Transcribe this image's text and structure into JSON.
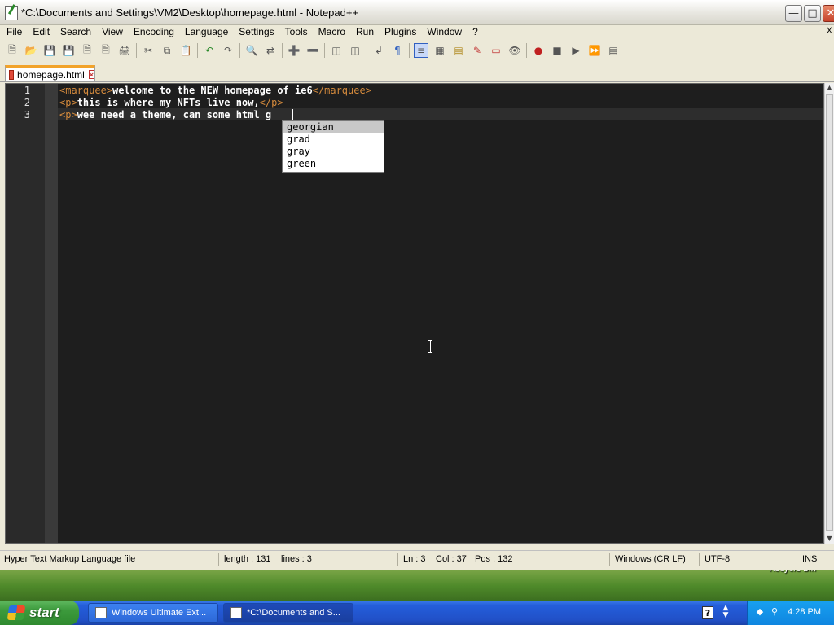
{
  "window": {
    "title": "*C:\\Documents and Settings\\VM2\\Desktop\\homepage.html - Notepad++"
  },
  "menubar": {
    "items": [
      "File",
      "Edit",
      "Search",
      "View",
      "Encoding",
      "Language",
      "Settings",
      "Tools",
      "Macro",
      "Run",
      "Plugins",
      "Window",
      "?"
    ],
    "close_x": "X"
  },
  "toolbar": {
    "icons": [
      "new-file-icon",
      "open-file-icon",
      "save-icon",
      "save-all-icon",
      "close-icon",
      "close-all-icon",
      "print-icon",
      "cut-icon",
      "copy-icon",
      "paste-icon",
      "undo-icon",
      "redo-icon",
      "find-icon",
      "replace-icon",
      "zoom-in-icon",
      "zoom-out-icon",
      "sync-vertical-icon",
      "sync-horizontal-icon",
      "word-wrap-icon",
      "show-all-chars-icon",
      "indent-guide-icon",
      "doc-map-icon",
      "function-list-icon",
      "folder-workspace-icon",
      "monitor-icon",
      "eye-icon",
      "record-macro-icon",
      "stop-macro-icon",
      "play-macro-icon",
      "run-macro-multiple-icon",
      "save-macro-icon"
    ]
  },
  "tabs": [
    {
      "label": "homepage.html"
    }
  ],
  "editor": {
    "line_numbers": [
      "1",
      "2",
      "3"
    ],
    "lines": [
      {
        "open_tag": "<marquee>",
        "text": "welcome to the NEW homepage of ie6",
        "close_tag": "</marquee>"
      },
      {
        "open_tag": "<p>",
        "text": "this is where my NFTs live now,",
        "close_tag": "</p>"
      },
      {
        "open_tag": "<p>",
        "text": "wee need a theme, can some html g",
        "close_tag": ""
      }
    ]
  },
  "autocomplete": {
    "items": [
      "georgian",
      "grad",
      "gray",
      "green"
    ],
    "selected_index": 0
  },
  "statusbar": {
    "file_type": "Hyper Text Markup Language file",
    "length": "length : 131",
    "lines": "lines : 3",
    "ln": "Ln : 3",
    "col": "Col : 37",
    "pos": "Pos : 132",
    "eol": "Windows (CR LF)",
    "encoding": "UTF-8",
    "mode": "INS"
  },
  "desktop": {
    "recycle_bin_label": "Recycle Bin"
  },
  "taskbar": {
    "start_label": "start",
    "tasks": [
      {
        "label": "Windows Ultimate Ext..."
      },
      {
        "label": "*C:\\Documents and S..."
      }
    ],
    "clock": "4:28 PM",
    "help_label": "?"
  }
}
